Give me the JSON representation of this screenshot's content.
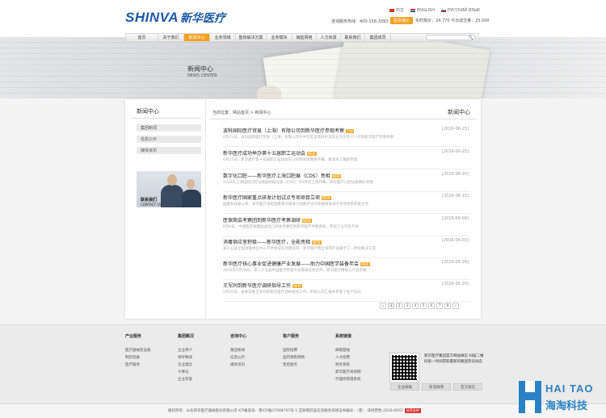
{
  "header": {
    "logo_en": "SHINVA",
    "logo_cn": "新华医疗",
    "langs": [
      "中文",
      "ENGLISH",
      "РУССКИЙ ЯЗЫК"
    ],
    "hotline_label": "咨询服务热线：400-158-3393",
    "quote_tag": "股票报价",
    "quote_text": "实时报价：24.770 今日成交量：25.000"
  },
  "nav": {
    "items": [
      "首页",
      "关于我们",
      "新闻中心",
      "业务领域",
      "整体解决方案",
      "业务模块",
      "销售网络",
      "人力资源",
      "联系我们",
      "集团成员"
    ],
    "active_index": 2,
    "search_placeholder": "🔍"
  },
  "banner": {
    "title": "新闻中心",
    "subtitle": "NEWS CENTER"
  },
  "sidebar": {
    "title": "新闻中心",
    "items": [
      "集团新闻",
      "信息公示",
      "媒体资讯"
    ],
    "contact_cn": "联系我们",
    "contact_en": "CONTACT US"
  },
  "main": {
    "breadcrumb": "当前位置：网站首页 > 新闻中心",
    "title": "新闻中心",
    "news": [
      {
        "title": "波科国际医疗贸易（上海）有限公司到新华医疗参观考察",
        "badge": "TOP",
        "date": "[2016-06-25]",
        "summary": "6月25日，波科国际医疗贸易（上海）有限公司大中华区首席财务官及业务负责人一行到新华医疗参观考察"
      },
      {
        "title": "新华医疗成功举办第十五届职工运动会",
        "badge": "NEW",
        "date": "[2016-06-25]",
        "summary": "6月25日，新华医疗第十五届职工运动会在公司体育场隆重开幕，集团员工踊跃参加"
      },
      {
        "title": "数字化口腔——新华医疗上海口腔展（CDS）亮相",
        "badge": "NEW",
        "date": "[2016-06-20]",
        "summary": "2016年上海国际口腔设备器材展览会（CDS）于6月在上海开幕，新华医疗口腔设备精彩亮相"
      },
      {
        "title": "新华医疗国家重点研发计划试点专项项目立项",
        "badge": "NEW",
        "date": "[2016-06-15]",
        "summary": "国家科技部公布，新华医疗承担国家重点研发计划数字诊疗装备研发试点专项项目获批立项"
      },
      {
        "title": "医保商会考察团到新华医疗考察调研",
        "badge": "NEW",
        "date": "[2016-06-08]",
        "summary": "6月8日，中国医药保健品进出口商会考察团到新华医疗考察调研，参观了公司生产线"
      },
      {
        "title": "消毒供应室积极——新华医疗，全能亮相",
        "badge": "NEW",
        "date": "[2016-06-01]",
        "summary": "第十五届全国消毒供应中心学术会议在合肥召开，新华医疗携全系列产品展示了一体化解决方案"
      },
      {
        "title": "新华医疗核心事业促进健康产业发展——助力中国医学装备年会",
        "badge": "NEW",
        "date": "[2016-05-28]",
        "summary": "2016年5月26日，第二十五届中国医学装备大会暨展览会召开，新华医疗携核心产品参展"
      },
      {
        "title": "王军同到新华医疗调研指导工作",
        "badge": "NEW",
        "date": "[2016-05-20]",
        "summary": "5月20日，省委常委王军同到新华医疗调研指导工作，听取公司汇报并参观了生产车间"
      }
    ],
    "pager": [
      "«",
      "1",
      "2",
      "3",
      "4",
      "5",
      "6",
      "7",
      "8",
      "»"
    ],
    "pager_current": 1
  },
  "footer": {
    "cols": [
      {
        "head": "产业服务",
        "links": [
          "医疗器械及设备",
          "制药装备",
          "医疗服务"
        ]
      },
      {
        "head": "集团概况",
        "links": [
          "企业简介",
          "领导致辞",
          "企业理念",
          "大事记",
          "企业荣誉"
        ]
      },
      {
        "head": "咨询中心",
        "links": [
          "集团新闻",
          "信息公示",
          "媒体资讯"
        ]
      },
      {
        "head": "客户服务",
        "links": [
          "国际招聘",
          "国内销售网络",
          "售后服务"
        ]
      },
      {
        "head": "系统链接",
        "links": [
          "邮箱登陆",
          "人才招聘",
          "财务系统",
          "新华医疗采购网",
          "代理商管理系统"
        ]
      }
    ],
    "qr_text": "新华医疗集团官方网站微信 扫描二维码第一时间获取最新的集团资讯动态",
    "btns": [
      "企业邮箱",
      "新浪微博",
      "官方微信"
    ],
    "copyright": "版权所有：山东新华医疗器械股份有限公司    ICP备案号：鲁ICP备07008707号-1    互联网药品信息服务资格证书编号：（鲁）-非经营性-2016-0001",
    "copy_badge": "技术支持"
  },
  "watermark": {
    "line1": "HAI TAO",
    "line2": "海淘科技"
  },
  "colors": {
    "accent": "#f2a01e",
    "brand": "#1e5aa8",
    "watermark": "#2a82c4"
  }
}
